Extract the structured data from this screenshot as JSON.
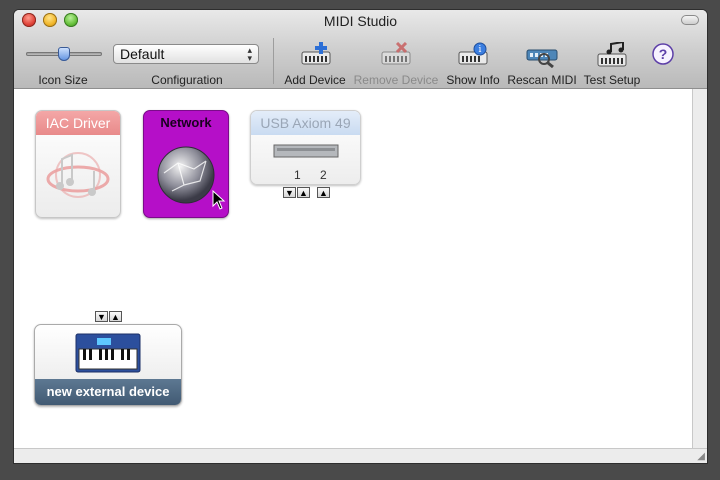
{
  "window": {
    "title": "MIDI Studio"
  },
  "toolbar": {
    "icon_size_label": "Icon Size",
    "icon_size_level": 0.5,
    "configuration_label": "Configuration",
    "configuration_value": "Default",
    "add_device_label": "Add Device",
    "remove_device_label": "Remove Device",
    "show_info_label": "Show Info",
    "rescan_midi_label": "Rescan MIDI",
    "test_setup_label": "Test Setup",
    "help_glyph": "?"
  },
  "devices": {
    "iac": {
      "label": "IAC Driver",
      "icon": "music-notes-icon"
    },
    "network": {
      "label": "Network",
      "icon": "globe-icon",
      "color": "#b50fc8"
    },
    "usb": {
      "label": "USB Axiom 49",
      "icon": "keyboard-device-icon",
      "port1": "1",
      "port2": "2"
    },
    "external": {
      "label": "new external device",
      "icon": "synth-keyboard-icon"
    }
  },
  "colors": {
    "iac_header": "#e88a8a",
    "usb_header": "#c9dbf1",
    "external_footer": "#4a647d",
    "network": "#b50fc8"
  }
}
